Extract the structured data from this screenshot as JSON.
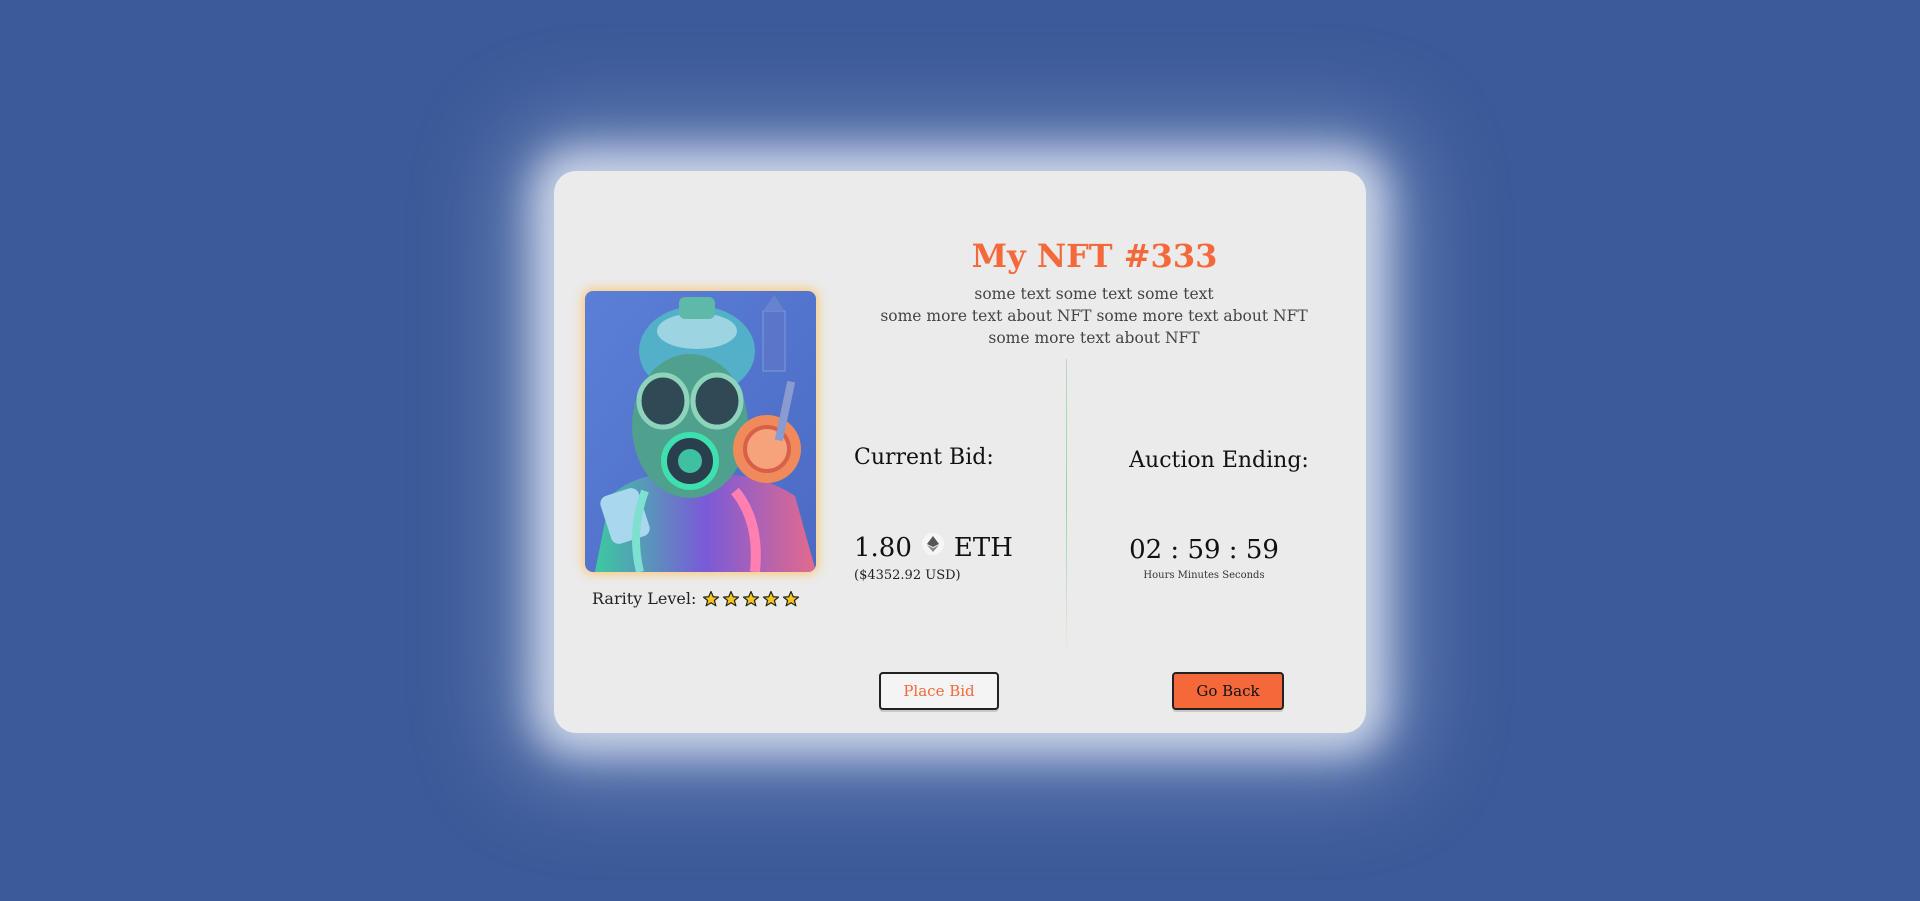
{
  "nft": {
    "title": "My NFT #333",
    "description_lines": [
      "some text some text some text",
      "some more text about NFT some more text about NFT",
      "some more text about NFT"
    ],
    "rarity_label": "Rarity Level:",
    "rarity_stars": 5,
    "image_alt": "gas mask art"
  },
  "bid": {
    "label": "Current Bid:",
    "amount": "1.80",
    "currency": "ETH",
    "usd": "($4352.92 USD)"
  },
  "auction": {
    "label": "Auction Ending:",
    "timer": "02 : 59 : 59",
    "units": "Hours Minutes Seconds"
  },
  "actions": {
    "place_bid": "Place Bid",
    "go_back": "Go Back"
  },
  "colors": {
    "background": "#3c5a99",
    "card": "#ebebeb",
    "accent": "#f4683a",
    "star": "#f5c518"
  },
  "icons": {
    "eth": "ethereum-icon",
    "star": "star-icon"
  }
}
